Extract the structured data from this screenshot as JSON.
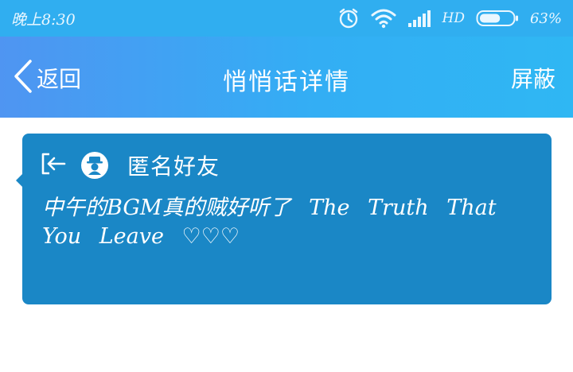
{
  "status_bar": {
    "time": "晚上8:30",
    "network_label": "HD",
    "battery_percent": "63%",
    "battery_level": 0.63,
    "icons": [
      "alarm-icon",
      "wifi-icon",
      "signal-icon",
      "battery-icon"
    ]
  },
  "nav": {
    "back_label": "返回",
    "title": "悄悄话详情",
    "block_label": "屏蔽"
  },
  "card": {
    "sender_name": "匿名好友",
    "message": "中午的BGM真的贼好听了 The Truth That You Leave ♡♡♡",
    "background_color": "#1a87c6"
  },
  "colors": {
    "status_bar": "#30aef0",
    "nav_gradient_start": "#4f95f2",
    "nav_gradient_end": "#2fb7f3"
  }
}
